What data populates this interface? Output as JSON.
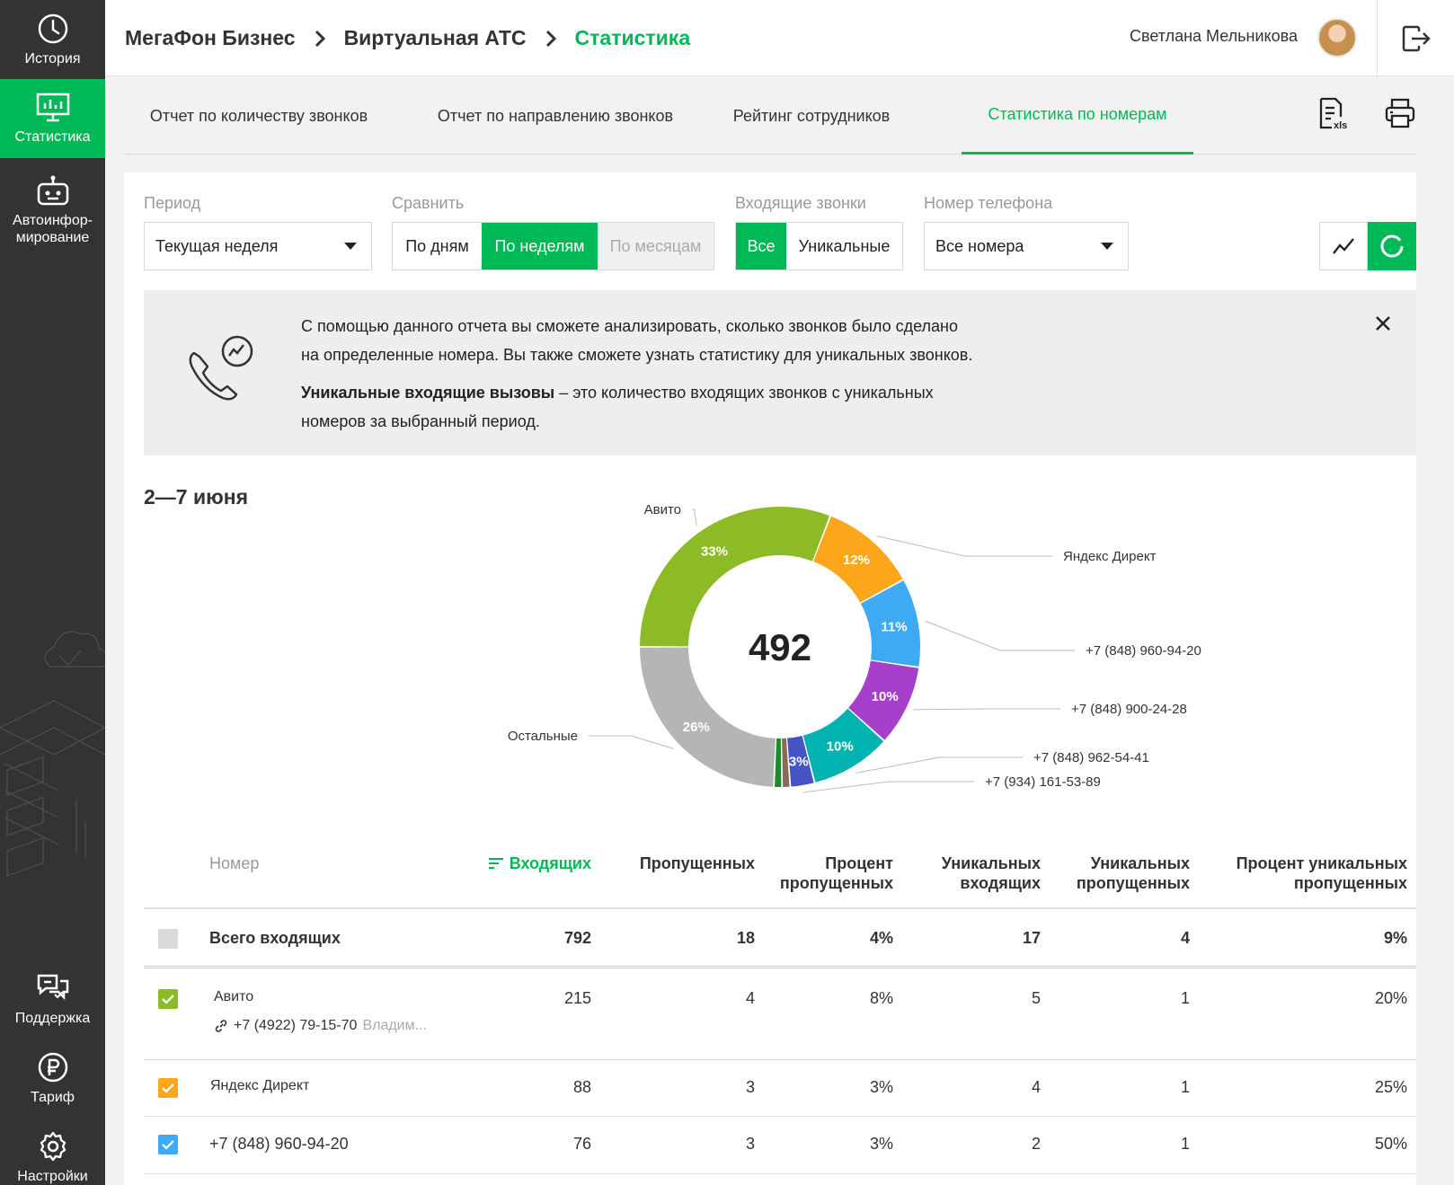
{
  "sidebar": {
    "items": [
      {
        "label": "История",
        "icon": "clock-icon"
      },
      {
        "label": "Статистика",
        "icon": "monitor-chart-icon"
      },
      {
        "label": "Автоинфор-\nмирование",
        "icon": "robot-icon"
      },
      {
        "label": "Поддержка",
        "icon": "chat-support-icon"
      },
      {
        "label": "Тариф",
        "icon": "ruble-icon"
      },
      {
        "label": "Настройки",
        "icon": "gear-icon"
      }
    ]
  },
  "header": {
    "breadcrumb": [
      "МегаФон Бизнес",
      "Виртуальная АТС",
      "Статистика"
    ],
    "user_name": "Светлана Мельникова"
  },
  "tabs": [
    {
      "label": "Отчет по количеству звонков"
    },
    {
      "label": "Отчет по направлению звонков"
    },
    {
      "label": "Рейтинг сотрудников"
    },
    {
      "label": "Статистика по номерам",
      "active": true
    }
  ],
  "filters": {
    "period_label": "Период",
    "period_value": "Текущая неделя",
    "compare_label": "Сравнить",
    "compare_options": [
      "По дням",
      "По неделям",
      "По месяцам"
    ],
    "incoming_label": "Входящие звонки",
    "incoming_options": [
      "Все",
      "Уникальные"
    ],
    "phone_label": "Номер телефона",
    "phone_value": "Все номера"
  },
  "info": {
    "line1": "С помощью данного отчета  вы сможете анализировать, сколько звонков было сделано",
    "line2": "на определенные номера. Вы также сможете узнать статистику для уникальных звонков.",
    "bold": "Уникальные входящие вызовы",
    "line3": " – это количество входящих звонков с уникальных",
    "line4": "номеров за выбранный период."
  },
  "period_title": "2—7 июня",
  "colors": {
    "accent": "#00b956",
    "sidebar": "#333333"
  },
  "chart_data": {
    "type": "pie",
    "center_value": "492",
    "slices": [
      {
        "label": "Авито",
        "value": 33,
        "color": "#8cbb25"
      },
      {
        "label": "Яндекс Директ",
        "value": 12,
        "color": "#fca61c"
      },
      {
        "label": "+7 (848) 960-94-20",
        "value": 11,
        "color": "#3ea9f5"
      },
      {
        "label": "+7 (848) 900-24-28",
        "value": 10,
        "color": "#a63fc9"
      },
      {
        "label": "+7 (848) 962-54-41",
        "value": 10,
        "color": "#00b2b0"
      },
      {
        "label": "+7 (934) 161-53-89",
        "value": 3,
        "color": "#4653c2"
      },
      {
        "label": "",
        "value": 1,
        "color": "#8b6b56"
      },
      {
        "label": "",
        "value": 1,
        "color": "#1e8a2c"
      },
      {
        "label": "Остальные",
        "value": 26,
        "color": "#b5b5b5"
      }
    ],
    "data_labels": [
      "33%",
      "12%",
      "11%",
      "10%",
      "10%",
      "3%",
      "",
      "",
      "26%"
    ]
  },
  "table": {
    "headers": [
      "Номер",
      "Входящих",
      "Пропущенных",
      "Процент\nпропущенных",
      "Уникальных\nвходящих",
      "Уникальных\nпропущенных",
      "Процент уникальных\nпропущенных"
    ],
    "total": {
      "name": "Всего входящих",
      "cells": [
        "792",
        "18",
        "4%",
        "17",
        "4",
        "9%"
      ]
    },
    "rows": [
      {
        "name": "Авито",
        "sub": "+7 (4922) 79-15-70",
        "sub_dim": "Владим...",
        "color": "#8cbb25",
        "cells": [
          "215",
          "4",
          "8%",
          "5",
          "1",
          "20%"
        ]
      },
      {
        "name": "Яндекс Директ",
        "color": "#fca61c",
        "cells": [
          "88",
          "3",
          "3%",
          "4",
          "1",
          "25%"
        ]
      },
      {
        "name": "+7 (848) 960-94-20",
        "color": "#3ea9f5",
        "cells": [
          "76",
          "3",
          "3%",
          "2",
          "1",
          "50%"
        ]
      }
    ]
  }
}
